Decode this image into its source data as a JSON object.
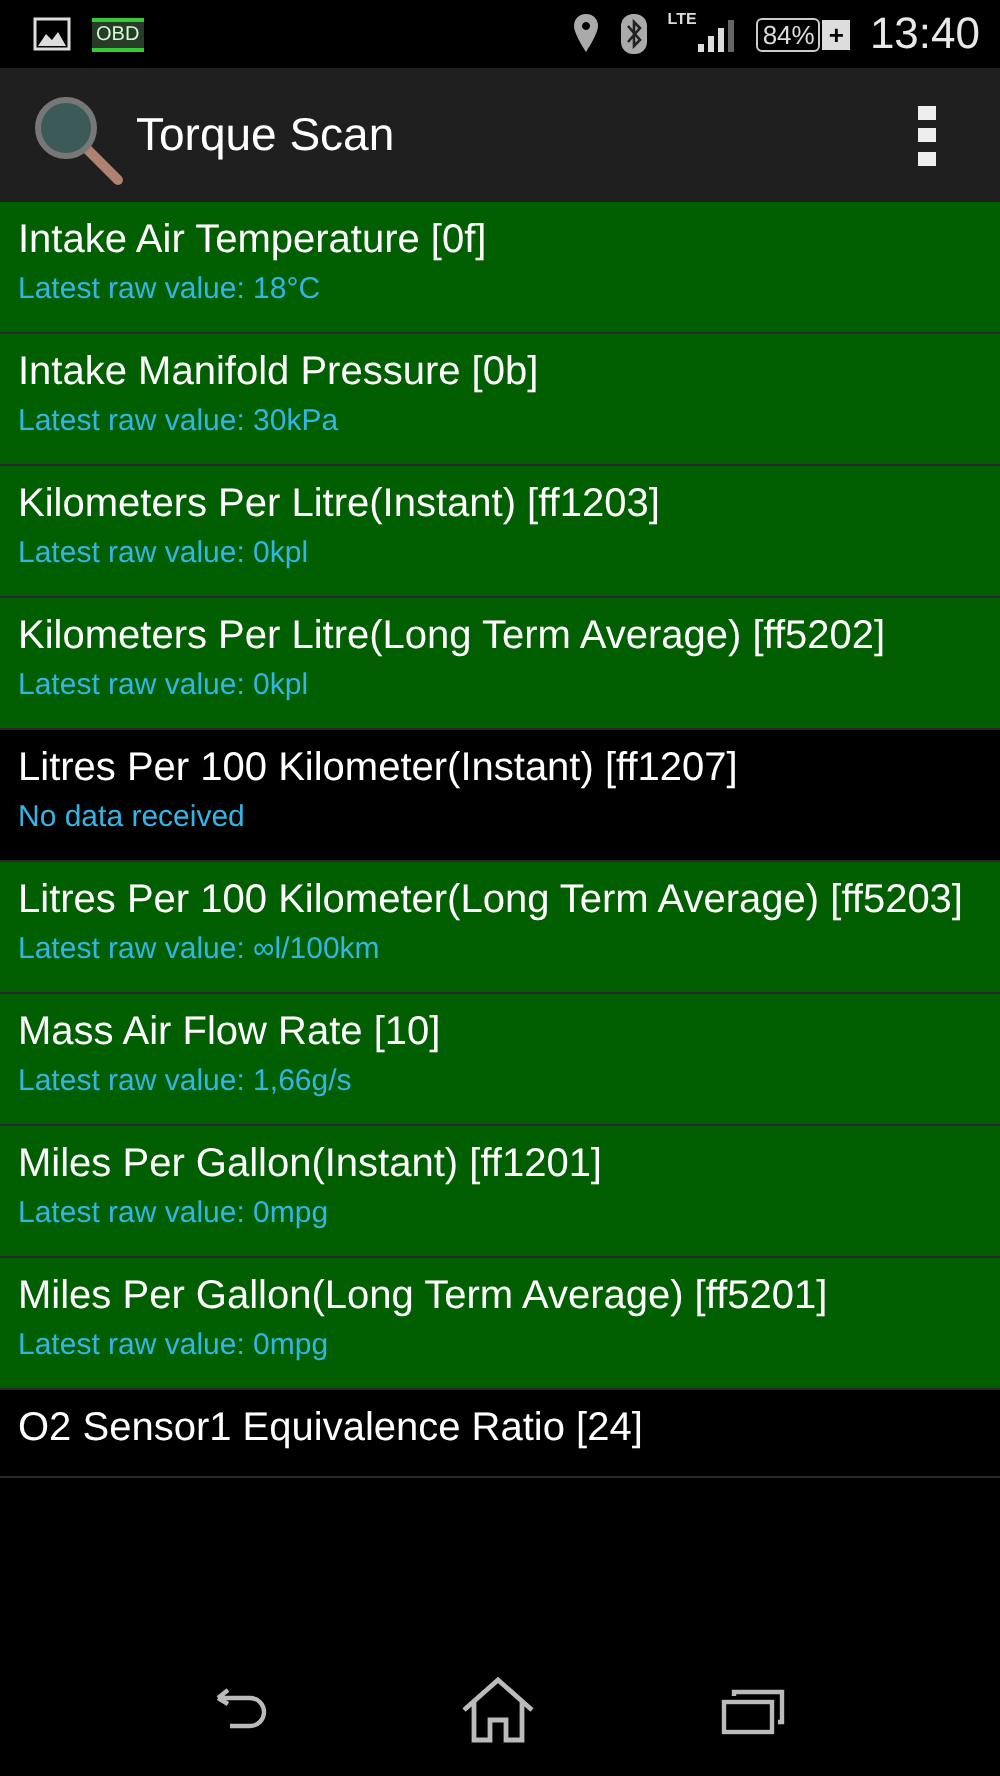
{
  "status_bar": {
    "obd_label": "OBD",
    "network": "LTE",
    "battery": "84%",
    "charging": "+",
    "time": "13:40"
  },
  "action_bar": {
    "title": "Torque Scan"
  },
  "items": [
    {
      "title": "Intake Air Temperature [0f]",
      "subtitle": "Latest raw value: 18°C",
      "highlighted": true
    },
    {
      "title": "Intake Manifold Pressure [0b]",
      "subtitle": "Latest raw value: 30kPa",
      "highlighted": true
    },
    {
      "title": "Kilometers Per Litre(Instant) [ff1203]",
      "subtitle": "Latest raw value: 0kpl",
      "highlighted": true
    },
    {
      "title": "Kilometers Per Litre(Long Term Average) [ff5202]",
      "subtitle": "Latest raw value: 0kpl",
      "highlighted": true
    },
    {
      "title": "Litres Per 100 Kilometer(Instant) [ff1207]",
      "subtitle": "No data received",
      "highlighted": false
    },
    {
      "title": "Litres Per 100 Kilometer(Long Term Average) [ff5203]",
      "subtitle": "Latest raw value: ∞l/100km",
      "highlighted": true
    },
    {
      "title": "Mass Air Flow Rate [10]",
      "subtitle": "Latest raw value: 1,66g/s",
      "highlighted": true
    },
    {
      "title": "Miles Per Gallon(Instant) [ff1201]",
      "subtitle": "Latest raw value: 0mpg",
      "highlighted": true
    },
    {
      "title": "Miles Per Gallon(Long Term Average) [ff5201]",
      "subtitle": "Latest raw value: 0mpg",
      "highlighted": true
    },
    {
      "title": "O2 Sensor1 Equivalence Ratio [24]",
      "highlighted": false
    }
  ]
}
